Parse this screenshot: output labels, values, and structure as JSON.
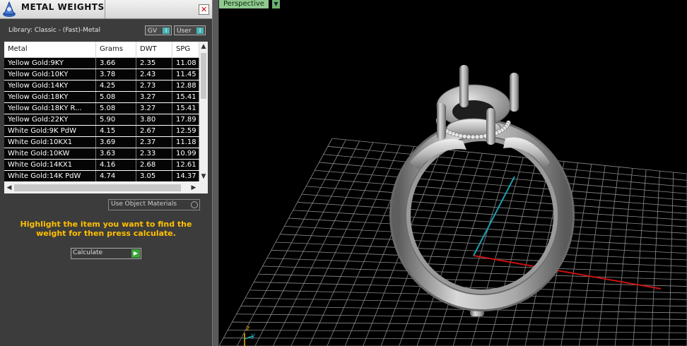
{
  "panel": {
    "title": "METAL WEIGHTS",
    "close_glyph": "✕",
    "library_label": "Library: Classic - (Fast)-Metal",
    "toggles": [
      {
        "label": "GV",
        "glyph": "I"
      },
      {
        "label": "User",
        "glyph": "I"
      }
    ],
    "table": {
      "columns": [
        "Metal",
        "Grams",
        "DWT",
        "SPG"
      ],
      "rows": [
        [
          "Yellow Gold:9KY",
          "3.66",
          "2.35",
          "11.08"
        ],
        [
          "Yellow Gold:10KY",
          "3.78",
          "2.43",
          "11.45"
        ],
        [
          "Yellow Gold:14KY",
          "4.25",
          "2.73",
          "12.88"
        ],
        [
          "Yellow Gold:18KY",
          "5.08",
          "3.27",
          "15.41"
        ],
        [
          "Yellow Gold:18KY R...",
          "5.08",
          "3.27",
          "15.41"
        ],
        [
          "Yellow Gold:22KY",
          "5.90",
          "3.80",
          "17.89"
        ],
        [
          "White Gold:9K PdW",
          "4.15",
          "2.67",
          "12.59"
        ],
        [
          "White Gold:10KX1",
          "3.69",
          "2.37",
          "11.18"
        ],
        [
          "White Gold:10KW",
          "3.63",
          "2.33",
          "10.99"
        ],
        [
          "White Gold:14KX1",
          "4.16",
          "2.68",
          "12.61"
        ],
        [
          "White Gold:14K PdW",
          "4.74",
          "3.05",
          "14.37"
        ]
      ]
    },
    "use_object_materials": "Use Object Materials",
    "hint": "Highlight the item you want to find the weight for then press calculate.",
    "calculate_label": "Calculate"
  },
  "viewport": {
    "view_name": "Perspective",
    "axis_z": "z",
    "axis_y": "y"
  },
  "colors": {
    "hint": "#ffc000",
    "view_tab": "#8fc98f",
    "toggle_accent": "#49b3b3",
    "calculate_accent": "#3aa33a",
    "x_axis": "#cc1111",
    "y_axis": "#1a9fb0",
    "grid": "#8a8a8a"
  },
  "icons": [
    "app-logo-icon",
    "close-icon",
    "toggle-indicator-icon",
    "scroll-up-icon",
    "scroll-down-icon",
    "scroll-left-icon",
    "scroll-right-icon",
    "play-arrow-icon",
    "dropdown-arrow-icon",
    "axis-gizmo-icon"
  ]
}
